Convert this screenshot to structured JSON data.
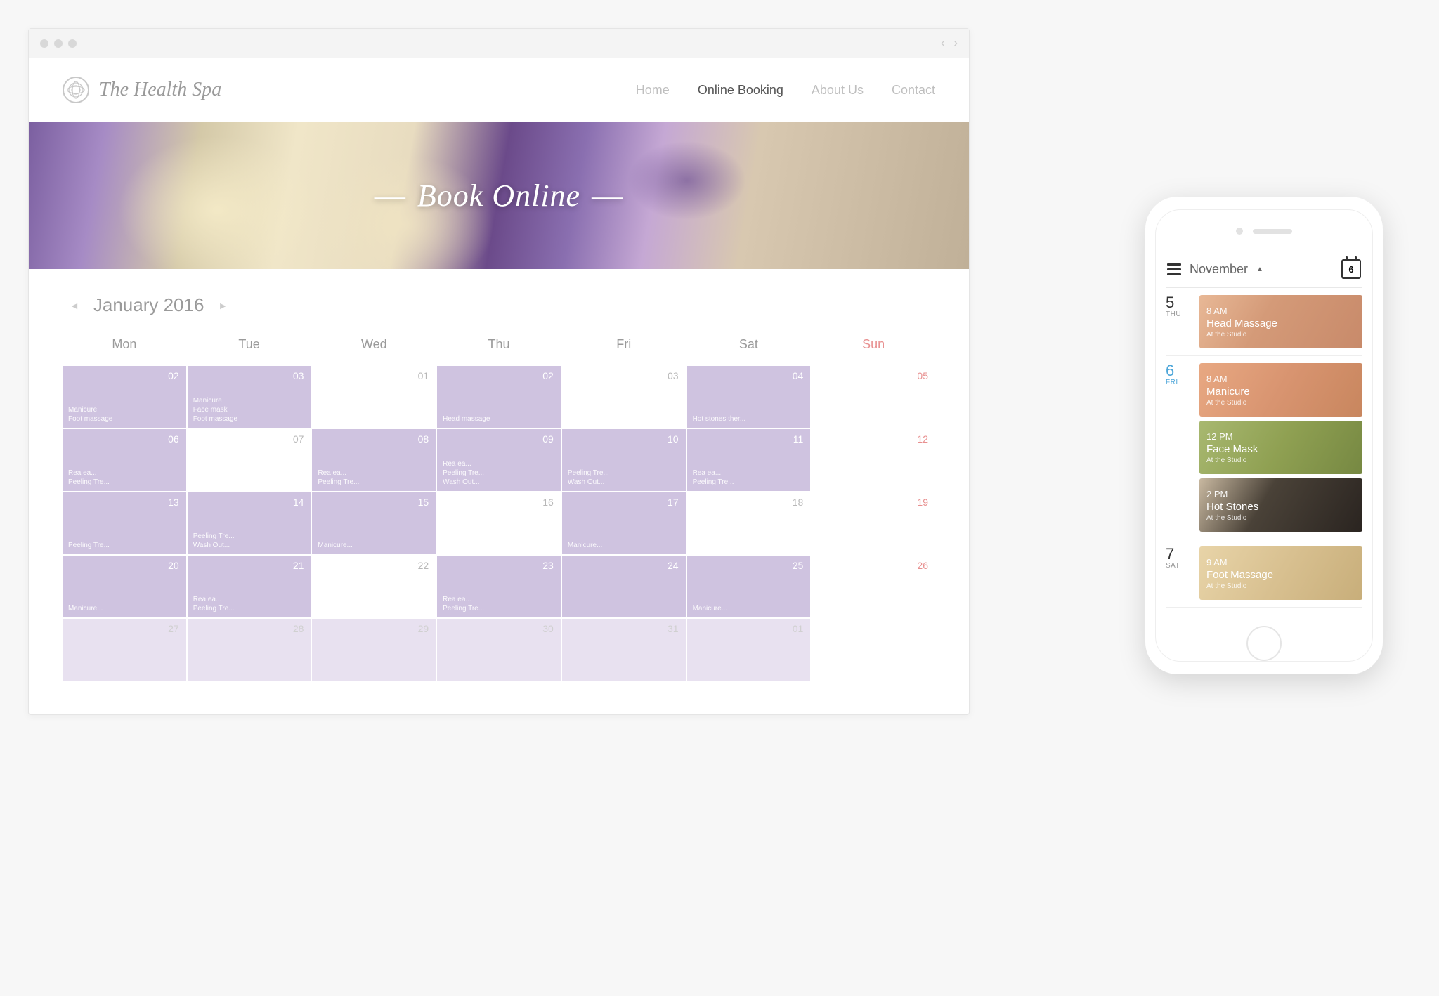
{
  "browser": {
    "site_name": "The Health Spa",
    "nav": [
      "Home",
      "Online Booking",
      "About Us",
      "Contact"
    ],
    "active_nav": "Online Booking",
    "hero_title": "Book Online"
  },
  "calendar": {
    "month_label": "January 2016",
    "weekdays": [
      "Mon",
      "Tue",
      "Wed",
      "Thu",
      "Fri",
      "Sat",
      "Sun"
    ],
    "cells": [
      {
        "num": "02",
        "type": "fill",
        "events": [
          "Manicure",
          "Foot massage"
        ]
      },
      {
        "num": "03",
        "type": "fill",
        "events": [
          "Manicure",
          "Face mask",
          "Foot massage"
        ]
      },
      {
        "num": "01",
        "type": "empty",
        "events": []
      },
      {
        "num": "02",
        "type": "fill",
        "events": [
          "Head massage"
        ]
      },
      {
        "num": "03",
        "type": "empty",
        "events": []
      },
      {
        "num": "04",
        "type": "fill",
        "events": [
          "Hot stones ther..."
        ]
      },
      {
        "num": "05",
        "type": "empty",
        "sun": true,
        "events": []
      },
      {
        "num": "06",
        "type": "fill",
        "events": [
          "Rea ea...",
          "Peeling Tre..."
        ]
      },
      {
        "num": "07",
        "type": "empty",
        "events": []
      },
      {
        "num": "08",
        "type": "fill",
        "events": [
          "Rea ea...",
          "Peeling Tre..."
        ]
      },
      {
        "num": "09",
        "type": "fill",
        "events": [
          "Rea ea...",
          "Peeling Tre...",
          "Wash Out..."
        ]
      },
      {
        "num": "10",
        "type": "fill",
        "events": [
          "Peeling Tre...",
          "Wash Out..."
        ]
      },
      {
        "num": "11",
        "type": "fill",
        "events": [
          "Rea ea...",
          "Peeling Tre..."
        ]
      },
      {
        "num": "12",
        "type": "empty",
        "sun": true,
        "events": []
      },
      {
        "num": "13",
        "type": "fill",
        "events": [
          "Peeling Tre..."
        ]
      },
      {
        "num": "14",
        "type": "fill",
        "events": [
          "Peeling Tre...",
          "Wash Out..."
        ]
      },
      {
        "num": "15",
        "type": "fill",
        "events": [
          "Manicure..."
        ]
      },
      {
        "num": "16",
        "type": "empty",
        "events": []
      },
      {
        "num": "17",
        "type": "fill",
        "events": [
          "Manicure..."
        ]
      },
      {
        "num": "18",
        "type": "empty",
        "events": []
      },
      {
        "num": "19",
        "type": "empty",
        "sun": true,
        "events": []
      },
      {
        "num": "20",
        "type": "fill",
        "events": [
          "Manicure..."
        ]
      },
      {
        "num": "21",
        "type": "fill",
        "events": [
          "Rea ea...",
          "Peeling Tre..."
        ]
      },
      {
        "num": "22",
        "type": "empty",
        "events": []
      },
      {
        "num": "23",
        "type": "fill",
        "events": [
          "Rea ea...",
          "Peeling Tre..."
        ]
      },
      {
        "num": "24",
        "type": "fill",
        "events": []
      },
      {
        "num": "25",
        "type": "fill",
        "events": [
          "Manicure..."
        ]
      },
      {
        "num": "26",
        "type": "empty",
        "sun": true,
        "events": []
      },
      {
        "num": "27",
        "type": "faded",
        "events": []
      },
      {
        "num": "28",
        "type": "faded",
        "events": []
      },
      {
        "num": "29",
        "type": "faded",
        "events": []
      },
      {
        "num": "30",
        "type": "faded",
        "events": []
      },
      {
        "num": "31",
        "type": "faded",
        "events": []
      },
      {
        "num": "01",
        "type": "faded",
        "events": []
      },
      {
        "num": "",
        "type": "empty",
        "events": []
      }
    ]
  },
  "phone": {
    "month": "November",
    "today_icon": "6",
    "days": [
      {
        "num": "5",
        "dow": "THU",
        "today": false,
        "cards": [
          {
            "time": "8 AM",
            "title": "Head Massage",
            "loc": "At the Studio",
            "style": "c0"
          }
        ]
      },
      {
        "num": "6",
        "dow": "FRI",
        "today": true,
        "cards": [
          {
            "time": "8 AM",
            "title": "Manicure",
            "loc": "At the Studio",
            "style": "c1"
          },
          {
            "time": "12 PM",
            "title": "Face Mask",
            "loc": "At the Studio",
            "style": "c2"
          },
          {
            "time": "2 PM",
            "title": "Hot Stones",
            "loc": "At the Studio",
            "style": "c3"
          }
        ]
      },
      {
        "num": "7",
        "dow": "SAT",
        "today": false,
        "cards": [
          {
            "time": "9 AM",
            "title": "Foot Massage",
            "loc": "At the Studio",
            "style": "c4"
          }
        ]
      }
    ]
  }
}
